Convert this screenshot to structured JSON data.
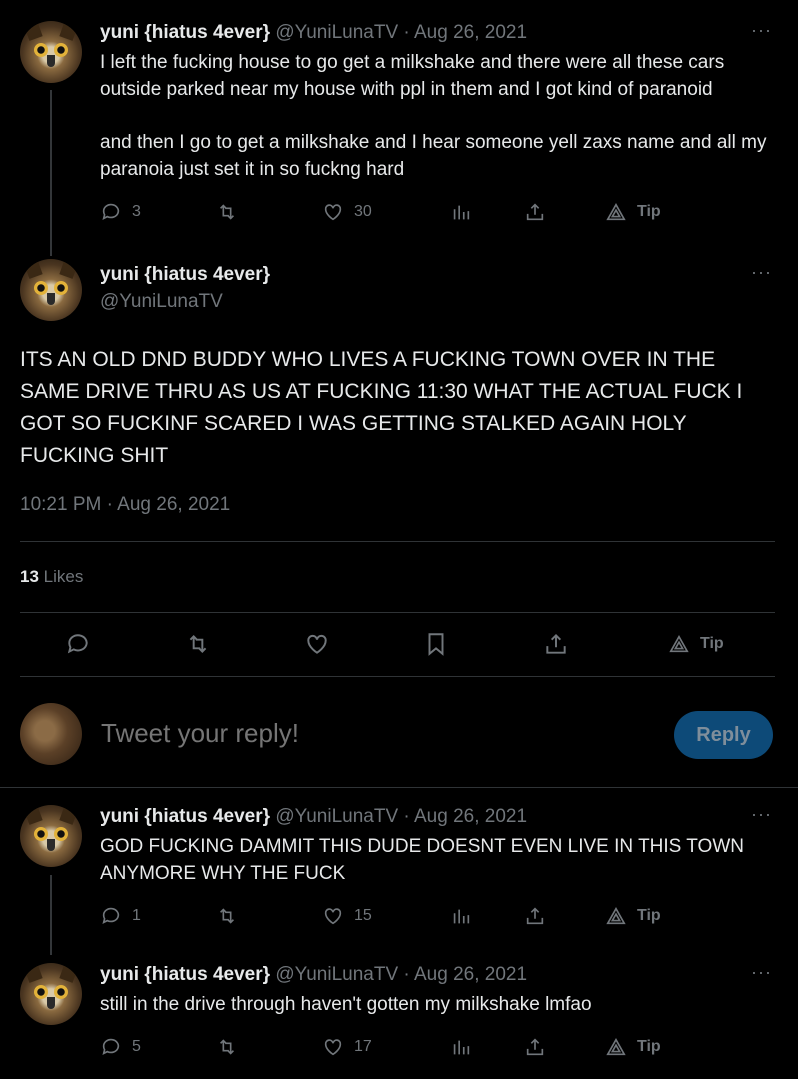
{
  "tweets": [
    {
      "name": "yuni {hiatus 4ever}",
      "handle": "@YuniLunaTV",
      "sep": "·",
      "date": "Aug 26, 2021",
      "text1": "I left the fucking house to go get a milkshake and there were all these cars outside parked near my house with ppl in them and I got kind of paranoid",
      "text2": "and then I go to get a milkshake and I hear someone yell zaxs name and all my paranoia just set it in so fuckng hard",
      "replies": "3",
      "likes": "30",
      "tip": "Tip"
    },
    {
      "name": "yuni {hiatus 4ever}",
      "handle": "@YuniLunaTV",
      "sep": "·",
      "date": "Aug 26, 2021",
      "text1": "GOD FUCKING DAMMIT THIS DUDE DOESNT EVEN LIVE IN THIS TOWN ANYMORE WHY THE FUCK",
      "replies": "1",
      "likes": "15",
      "tip": "Tip"
    },
    {
      "name": "yuni {hiatus 4ever}",
      "handle": "@YuniLunaTV",
      "sep": "·",
      "date": "Aug 26, 2021",
      "text1": "still in the drive through haven't gotten my milkshake lmfao",
      "replies": "5",
      "likes": "17",
      "tip": "Tip"
    }
  ],
  "main": {
    "name": "yuni {hiatus 4ever}",
    "handle": "@YuniLunaTV",
    "text": "ITS AN OLD DND BUDDY WHO LIVES A FUCKING TOWN OVER IN THE SAME DRIVE THRU AS US AT FUCKING 11:30 WHAT THE ACTUAL FUCK I GOT SO FUCKINF SCARED I WAS GETTING STALKED AGAIN HOLY FUCKING SHIT",
    "timestamp": "10:21 PM · Aug 26, 2021",
    "likes_count": "13",
    "likes_label": "Likes",
    "tip": "Tip"
  },
  "reply_box": {
    "placeholder": "Tweet your reply!",
    "button": "Reply"
  },
  "more_glyph": "···"
}
